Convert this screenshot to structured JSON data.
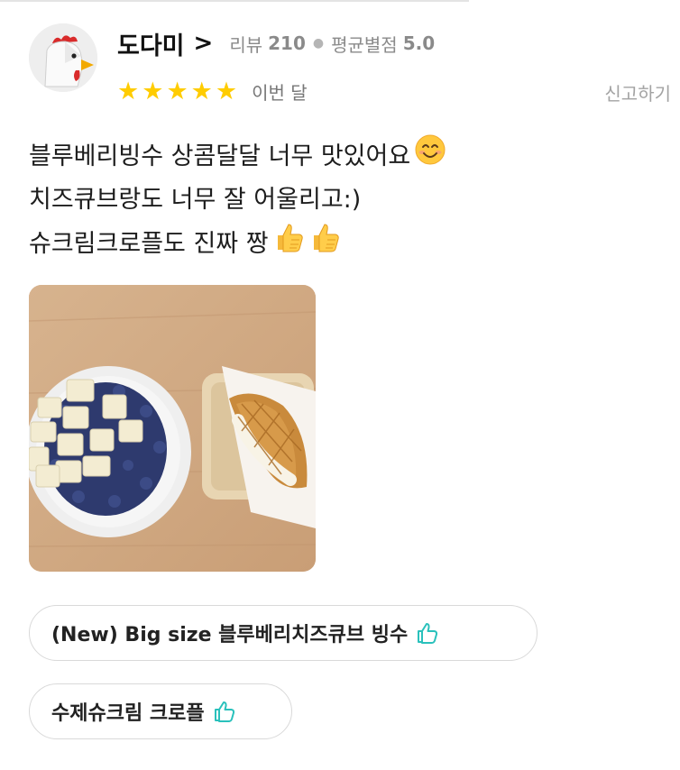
{
  "user": {
    "nickname": "도다미",
    "review_label": "리뷰",
    "review_count": "210",
    "avg_label": "평균별점",
    "avg_score": "5.0"
  },
  "rating": {
    "stars": 5,
    "star_char": "★",
    "when": "이번 달",
    "star_color": "#ffcc00"
  },
  "actions": {
    "report_label": "신고하기"
  },
  "review": {
    "line1": "블루베리빙수 상콤달달 너무 맛있어요",
    "line2": "치즈큐브랑도 너무 잘 어울리고:)",
    "line3": "슈크림크로플도 진짜 짱"
  },
  "menus": [
    {
      "label": "(New) Big size 블루베리치즈큐브 빙수",
      "icon": "thumbs-up-icon"
    },
    {
      "label": "수제슈크림 크로플",
      "icon": "thumbs-up-icon"
    }
  ],
  "colors": {
    "thumb_icon": "#2ac1bc"
  }
}
